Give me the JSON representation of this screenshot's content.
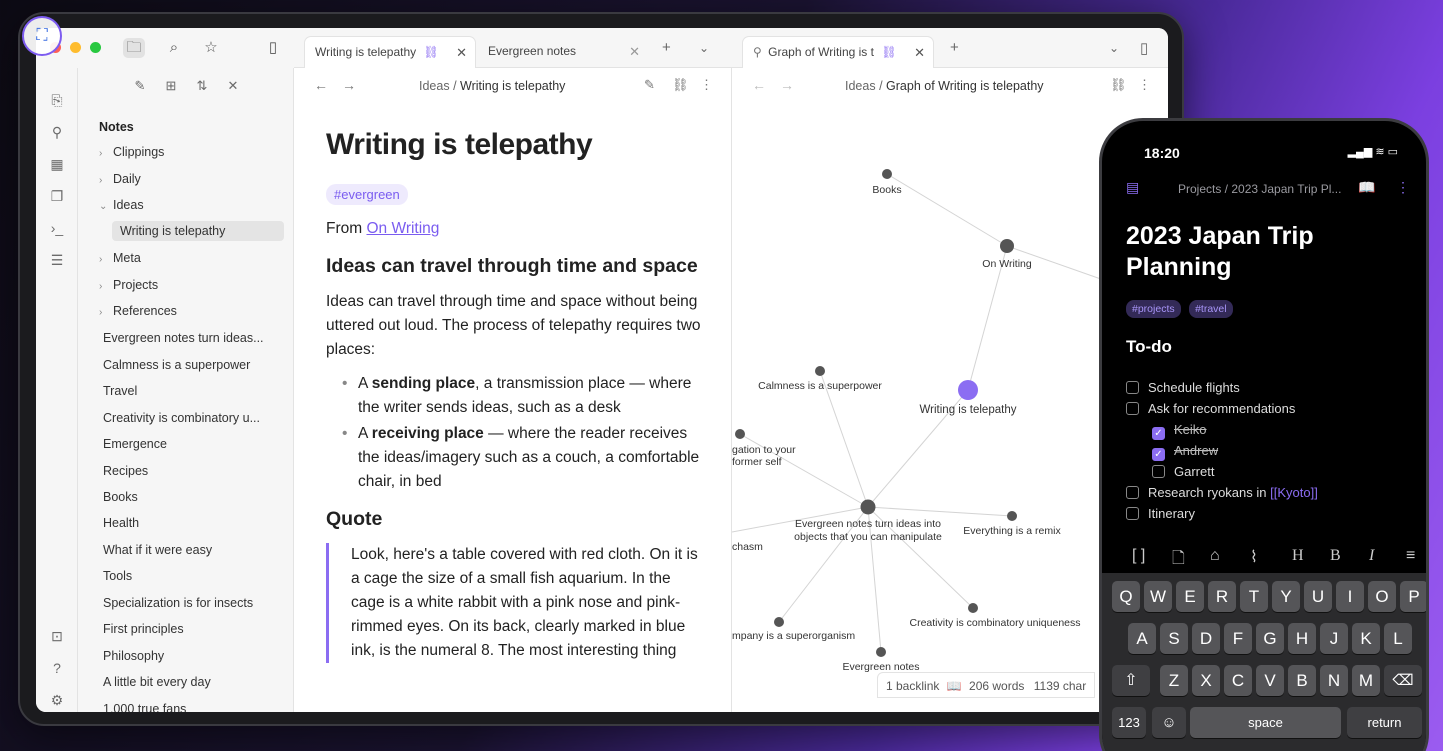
{
  "window": {
    "traffic_lights": [
      "#fe5f57",
      "#febc2e",
      "#28c840"
    ],
    "accent": "#7a5cf0"
  },
  "ribbon": [
    "open-note-icon",
    "graph-icon",
    "calendar-icon",
    "pages-icon",
    "terminal-icon",
    "new-canvas-icon",
    "vault-icon",
    "help-icon",
    "settings-icon"
  ],
  "sidebar": {
    "root": "Notes",
    "folders": [
      {
        "label": "Clippings",
        "open": false
      },
      {
        "label": "Daily",
        "open": false
      },
      {
        "label": "Ideas",
        "open": true
      },
      {
        "label": "Writing is telepathy",
        "child": true
      },
      {
        "label": "Meta",
        "open": false
      },
      {
        "label": "Projects",
        "open": false
      },
      {
        "label": "References",
        "open": false
      }
    ],
    "notes": [
      "Evergreen notes turn ideas...",
      "Calmness is a superpower",
      "Travel",
      "Creativity is combinatory u...",
      "Emergence",
      "Recipes",
      "Books",
      "Health",
      "What if it were easy",
      "Tools",
      "Specialization is for insects",
      "First principles",
      "Philosophy",
      "A little bit every day",
      "1,000 true fans"
    ]
  },
  "tabs": {
    "left": [
      {
        "label": "Writing is telepathy"
      },
      {
        "label": "Evergreen notes"
      }
    ],
    "right": [
      {
        "label": "Graph of Writing is t"
      }
    ]
  },
  "left_pane": {
    "crumb_parent": "Ideas",
    "crumb_sep": "/",
    "crumb_current": "Writing is telepathy",
    "title": "Writing is telepathy",
    "tag": "#evergreen",
    "from_prefix": "From",
    "from_link": "On Writing",
    "h2_1": "Ideas can travel through time and space",
    "para": "Ideas can travel through time and space without being uttered out loud. The process of telepathy requires two places:",
    "bullet1_a": "A",
    "bullet1_bold": "sending place",
    "bullet1_rest": ", a transmission place — where the writer sends ideas, such as a desk",
    "bullet2_a": "A",
    "bullet2_bold": "receiving place",
    "bullet2_rest": " — where the reader receives the ideas/imagery such as a couch, a comfortable chair, in bed",
    "h2_2": "Quote",
    "quote": "Look, here's a table covered with red cloth. On it is a cage the size of a small fish aquarium. In the cage is a white rabbit with a pink nose and pink-rimmed eyes. On its back, clearly marked in blue ink, is the numeral 8. The most interesting thing"
  },
  "right_pane": {
    "crumb_parent": "Ideas",
    "crumb_sep": "/",
    "crumb_current": "Graph of Writing is telepathy",
    "graph_nodes": [
      {
        "label": "Books"
      },
      {
        "label": "On Writing"
      },
      {
        "label": "Calmness is a superpower"
      },
      {
        "label": "Writing is telepathy"
      },
      {
        "label": "gation to your former self"
      },
      {
        "label": "Evergreen notes turn ideas into objects that you can manipulate"
      },
      {
        "label": "Everything is a remix"
      },
      {
        "label": "chasm"
      },
      {
        "label": "mpany is a superorganism"
      },
      {
        "label": "Creativity is combinatory uniqueness"
      },
      {
        "label": "Evergreen notes"
      }
    ],
    "status": {
      "backlinks": "1 backlink",
      "words": "206 words",
      "chars": "1139 char"
    }
  },
  "phone": {
    "time": "18:20",
    "crumb": "Projects / 2023 Japan Trip Pl...",
    "title": "2023 Japan Trip Planning",
    "tags": [
      "#projects",
      "#travel"
    ],
    "heading": "To-do",
    "todos": [
      {
        "text": "Schedule flights",
        "done": false
      },
      {
        "text": "Ask for recommendations",
        "done": false
      },
      {
        "text": "Keiko",
        "done": true
      },
      {
        "text": "Andrew",
        "done": true
      },
      {
        "text": "Garrett",
        "done": false
      },
      {
        "text": "Research ryokans in ",
        "link": "[[Kyoto]]",
        "done": false
      },
      {
        "text": "Itinerary",
        "done": false
      }
    ],
    "keyboard": {
      "row1": [
        "Q",
        "W",
        "E",
        "R",
        "T",
        "Y",
        "U",
        "I",
        "O",
        "P"
      ],
      "row2": [
        "A",
        "S",
        "D",
        "F",
        "G",
        "H",
        "J",
        "K",
        "L"
      ],
      "row3": [
        "Z",
        "X",
        "C",
        "V",
        "B",
        "N",
        "M"
      ],
      "numbers": "123",
      "space": "space",
      "return": "return"
    }
  }
}
